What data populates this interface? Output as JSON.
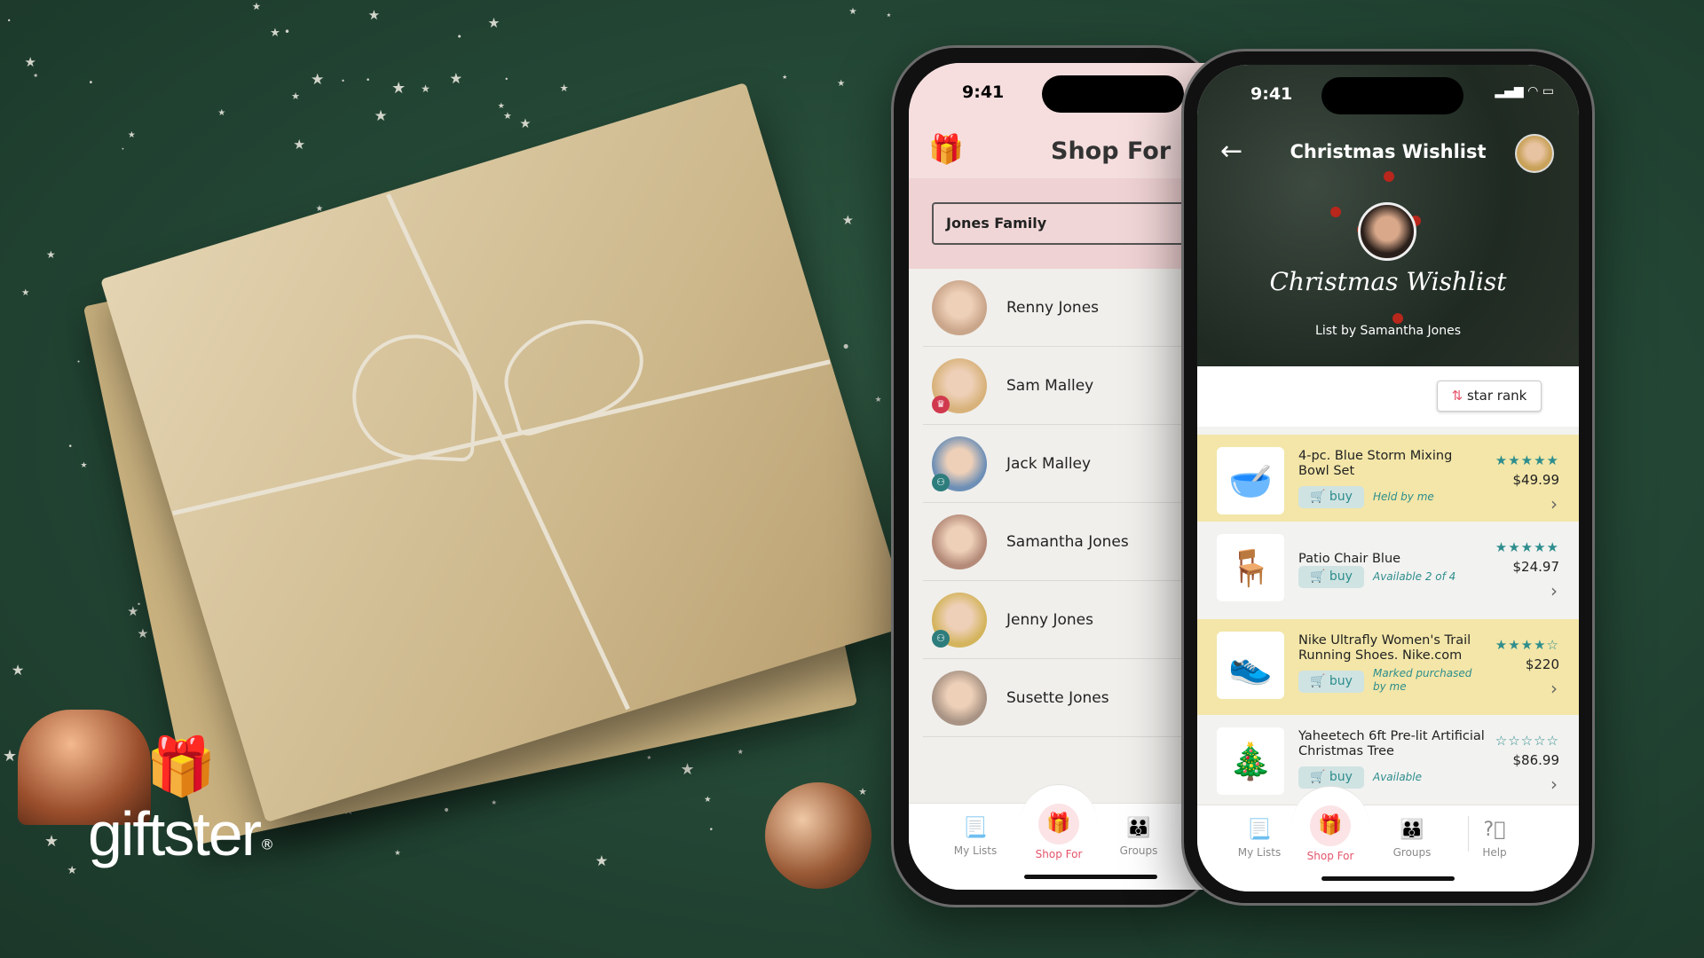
{
  "brand": {
    "logo_text": "giftster",
    "registered": "®"
  },
  "left_phone": {
    "status_time": "9:41",
    "header_title": "Shop For",
    "logo_icon": "giftster-family-icon",
    "group_select": {
      "value": "Jones Family"
    },
    "members": [
      {
        "name": "Renny Jones",
        "badge": ""
      },
      {
        "name": "Sam Malley",
        "badge": "crown"
      },
      {
        "name": "Jack Malley",
        "badge": "group"
      },
      {
        "name": "Samantha Jones",
        "badge": ""
      },
      {
        "name": "Jenny Jones",
        "badge": "group"
      },
      {
        "name": "Susette Jones",
        "badge": ""
      }
    ],
    "nav": [
      {
        "label": "My Lists",
        "icon": "list-icon"
      },
      {
        "label": "Shop For",
        "icon": "gift-icon",
        "active": true
      },
      {
        "label": "Groups",
        "icon": "groups-icon"
      }
    ]
  },
  "right_phone": {
    "status_time": "9:41",
    "header_title": "Christmas Wishlist",
    "list_title": "Christmas Wishlist",
    "list_by": "List by Samantha Jones",
    "sort_button": "star rank",
    "items": [
      {
        "name": "4-pc. Blue Storm Mixing Bowl Set",
        "stars": 5,
        "price": "$49.99",
        "status": "Held by me",
        "buy": "buy",
        "highlight": true
      },
      {
        "name": "Patio Chair Blue",
        "stars": 5,
        "price": "$24.97",
        "status": "Available 2 of 4",
        "buy": "buy",
        "highlight": false
      },
      {
        "name": "Nike Ultrafly Women's Trail Running Shoes. Nike.com",
        "stars": 4,
        "price": "$220",
        "status": "Marked purchased by me",
        "buy": "buy",
        "highlight": true
      },
      {
        "name": "Yaheetech 6ft Pre-lit Artificial Christmas Tree",
        "stars": 0,
        "price": "$86.99",
        "status": "Available",
        "buy": "buy",
        "highlight": false
      }
    ],
    "nav": [
      {
        "label": "My Lists",
        "icon": "list-icon"
      },
      {
        "label": "Shop For",
        "icon": "gift-icon",
        "active": true
      },
      {
        "label": "Groups",
        "icon": "groups-icon"
      },
      {
        "label": "Help",
        "icon": "help-icon"
      }
    ]
  },
  "colors": {
    "background": "#244a36",
    "accent": "#e4546a",
    "teal": "#2e8d8d",
    "highlight_row": "#f3e6a8",
    "header_pink": "#f6dede"
  }
}
